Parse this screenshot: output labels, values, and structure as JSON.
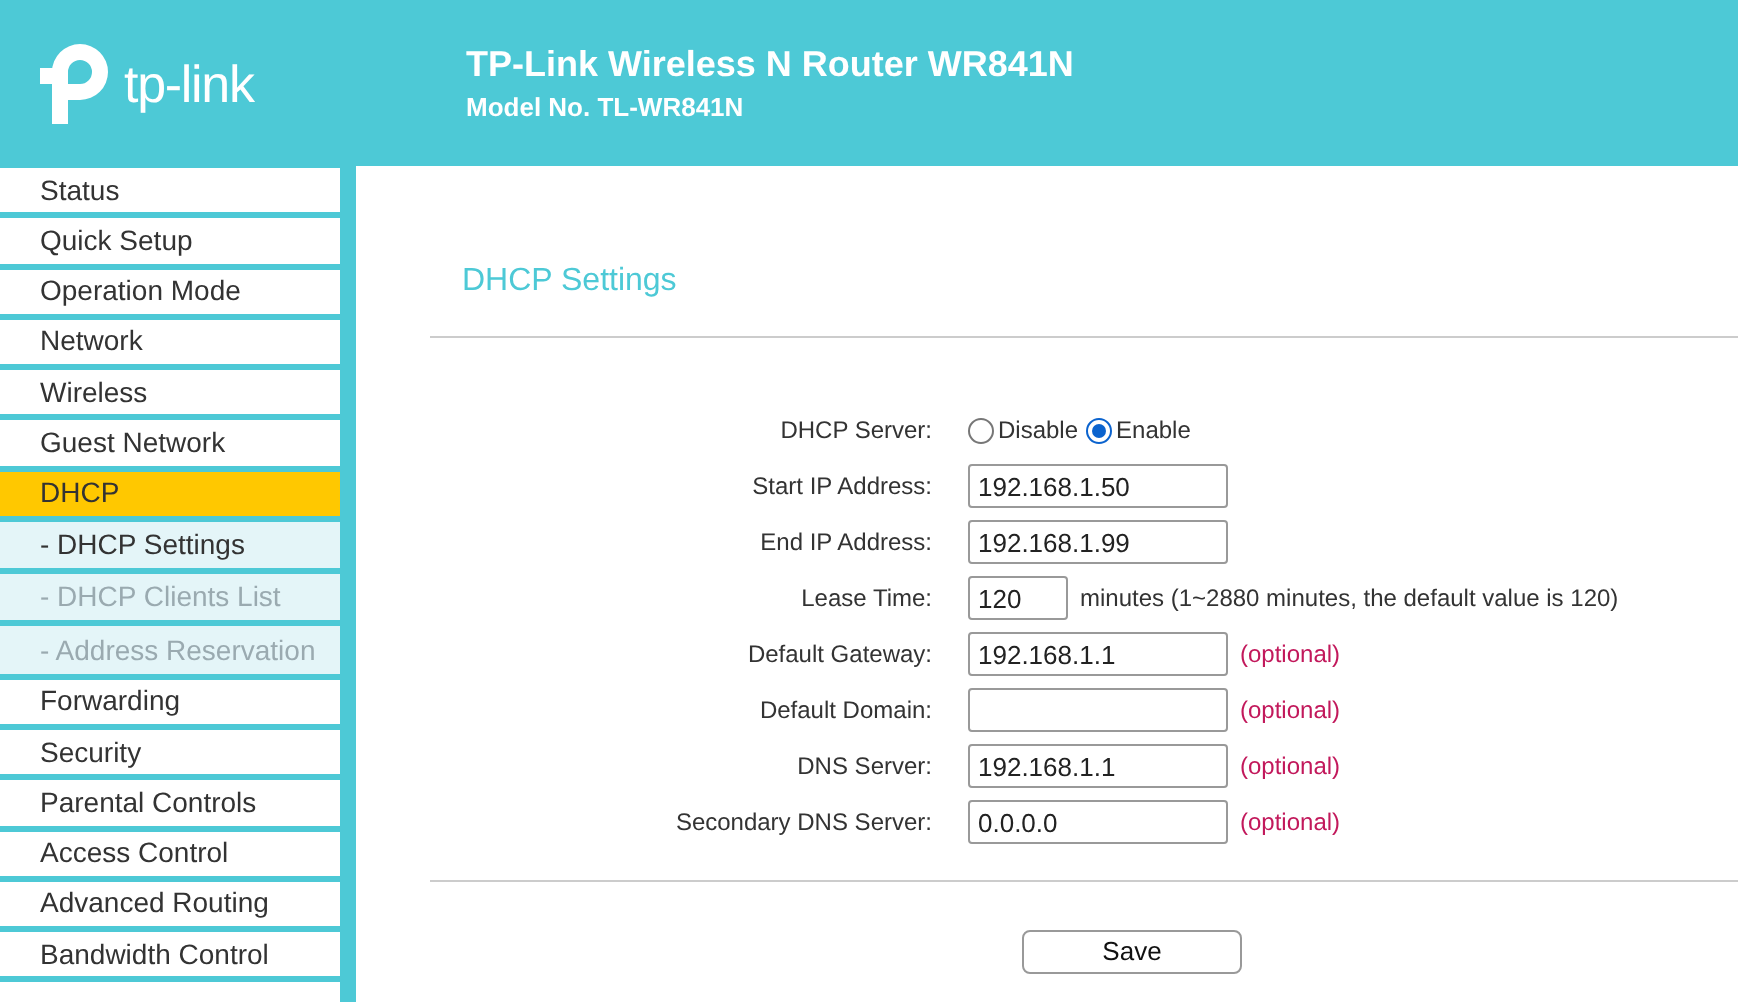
{
  "header": {
    "logo_text": "tp-link",
    "title": "TP-Link Wireless N Router WR841N",
    "subtitle": "Model No. TL-WR841N"
  },
  "sidebar": {
    "items": [
      {
        "label": "Status",
        "kind": "menu",
        "selected": false
      },
      {
        "label": "Quick Setup",
        "kind": "menu",
        "selected": false
      },
      {
        "label": "Operation Mode",
        "kind": "menu",
        "selected": false
      },
      {
        "label": "Network",
        "kind": "menu",
        "selected": false
      },
      {
        "label": "Wireless",
        "kind": "menu",
        "selected": false
      },
      {
        "label": "Guest Network",
        "kind": "menu",
        "selected": false
      },
      {
        "label": "DHCP",
        "kind": "menu",
        "selected": true
      },
      {
        "label": "- DHCP Settings",
        "kind": "submenu",
        "selected": true
      },
      {
        "label": "- DHCP Clients List",
        "kind": "submenu",
        "selected": false
      },
      {
        "label": "- Address Reservation",
        "kind": "submenu",
        "selected": false
      },
      {
        "label": "Forwarding",
        "kind": "menu",
        "selected": false
      },
      {
        "label": "Security",
        "kind": "menu",
        "selected": false
      },
      {
        "label": "Parental Controls",
        "kind": "menu",
        "selected": false
      },
      {
        "label": "Access Control",
        "kind": "menu",
        "selected": false
      },
      {
        "label": "Advanced Routing",
        "kind": "menu",
        "selected": false
      },
      {
        "label": "Bandwidth Control",
        "kind": "menu",
        "selected": false
      },
      {
        "kind": "cut"
      }
    ]
  },
  "content": {
    "title": "DHCP Settings",
    "fields": [
      {
        "label": "DHCP Server:",
        "kind": "radio",
        "options": [
          {
            "label": "Disable",
            "selected": false
          },
          {
            "label": "Enable",
            "selected": true
          }
        ]
      },
      {
        "label": "Start IP Address:",
        "kind": "text",
        "value": "192.168.1.50"
      },
      {
        "label": "End IP Address:",
        "kind": "text",
        "value": "192.168.1.99"
      },
      {
        "label": "Lease Time:",
        "kind": "number",
        "value": "120",
        "note": {
          "text": "minutes (1~2880 minutes, the default value is 120)",
          "kind": "info"
        }
      },
      {
        "label": "Default Gateway:",
        "kind": "text",
        "value": "192.168.1.1",
        "note": {
          "text": "(optional)",
          "kind": "optional"
        }
      },
      {
        "label": "Default Domain:",
        "kind": "text",
        "note": {
          "text": "(optional)",
          "kind": "optional"
        }
      },
      {
        "label": "DNS Server:",
        "kind": "text",
        "value": "192.168.1.1",
        "note": {
          "text": "(optional)",
          "kind": "optional"
        }
      },
      {
        "label": "Secondary DNS Server:",
        "kind": "text",
        "value": "0.0.0.0",
        "note": {
          "text": "(optional)",
          "kind": "optional"
        }
      }
    ],
    "save_button": "Save"
  }
}
